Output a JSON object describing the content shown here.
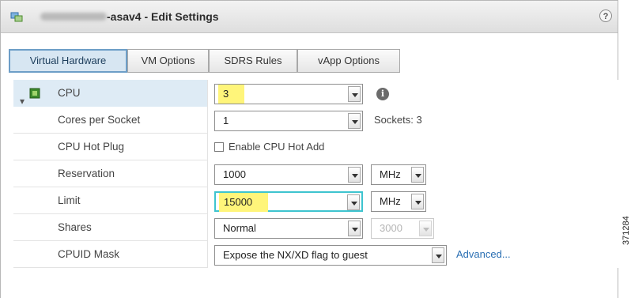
{
  "window": {
    "title": "-asav4 - Edit Settings",
    "help_label": "?"
  },
  "tabs": [
    {
      "label": "Virtual Hardware",
      "active": true
    },
    {
      "label": "VM Options",
      "active": false
    },
    {
      "label": "SDRS Rules",
      "active": false
    },
    {
      "label": "vApp Options",
      "active": false
    }
  ],
  "cpu": {
    "label": "CPU",
    "value": "3",
    "expand_glyph": "▾"
  },
  "cores_per_socket": {
    "label": "Cores per Socket",
    "value": "1",
    "sockets_text": "Sockets:  3"
  },
  "cpu_hot_plug": {
    "label": "CPU Hot Plug",
    "checkbox_label": "Enable CPU Hot Add",
    "checked": false
  },
  "reservation": {
    "label": "Reservation",
    "value": "1000",
    "unit": "MHz"
  },
  "limit": {
    "label": "Limit",
    "value": "15000",
    "unit": "MHz"
  },
  "shares": {
    "label": "Shares",
    "value": "Normal",
    "number": "3000"
  },
  "cpuid_mask": {
    "label": "CPUID Mask",
    "value": "Expose the NX/XD flag to guest",
    "link": "Advanced..."
  },
  "figure_id": "371284",
  "colors": {
    "highlight_yellow": "#fff57a",
    "highlight_cyan": "#3ec4cf",
    "selected_row": "#deebf5",
    "link": "#2a6fb3"
  }
}
